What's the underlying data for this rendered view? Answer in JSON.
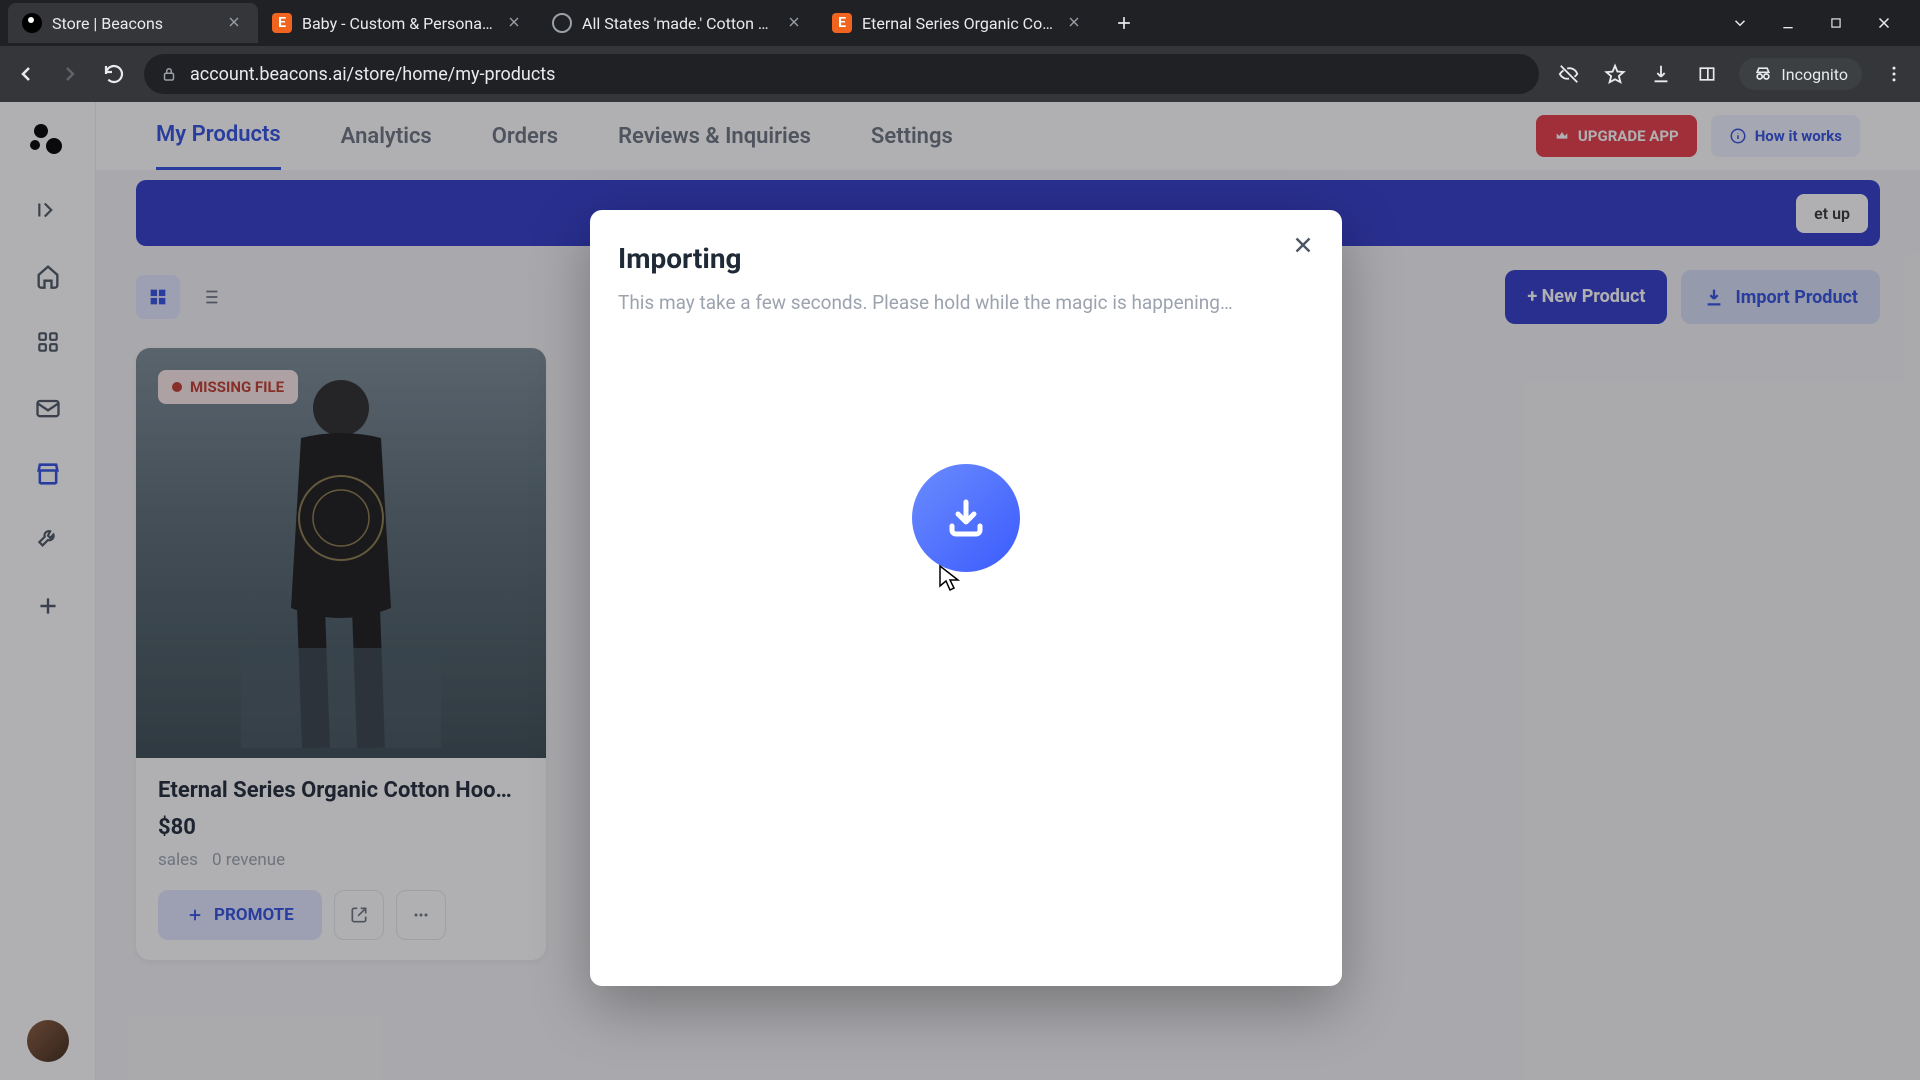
{
  "browser": {
    "tabs": [
      {
        "title": "Store | Beacons",
        "active": true,
        "favicon": "beacons"
      },
      {
        "title": "Baby - Custom & Personalised -",
        "active": false,
        "favicon": "etsy"
      },
      {
        "title": "All States 'made.' Cotton Baby O",
        "active": false,
        "favicon": "globe"
      },
      {
        "title": "Eternal Series Organic Cotton Ho",
        "active": false,
        "favicon": "etsy"
      }
    ],
    "url": "account.beacons.ai/store/home/my-products",
    "incognito_label": "Incognito"
  },
  "nav": {
    "tabs": [
      "My Products",
      "Analytics",
      "Orders",
      "Reviews & Inquiries",
      "Settings"
    ],
    "active": 0,
    "upgrade_label": "UPGRADE APP",
    "how_label": "How it works"
  },
  "banner": {
    "cta": "et up"
  },
  "toolbar": {
    "new_label": "+ New Product",
    "import_label": "Import Product"
  },
  "product": {
    "badge": "MISSING FILE",
    "title": "Eternal Series Organic Cotton Hoo…",
    "price": "$80",
    "sales_label": "sales",
    "revenue_label": "0 revenue",
    "promote_label": "PROMOTE"
  },
  "modal": {
    "title": "Importing",
    "subtitle": "This may take a few seconds. Please hold while the magic is happening…"
  }
}
